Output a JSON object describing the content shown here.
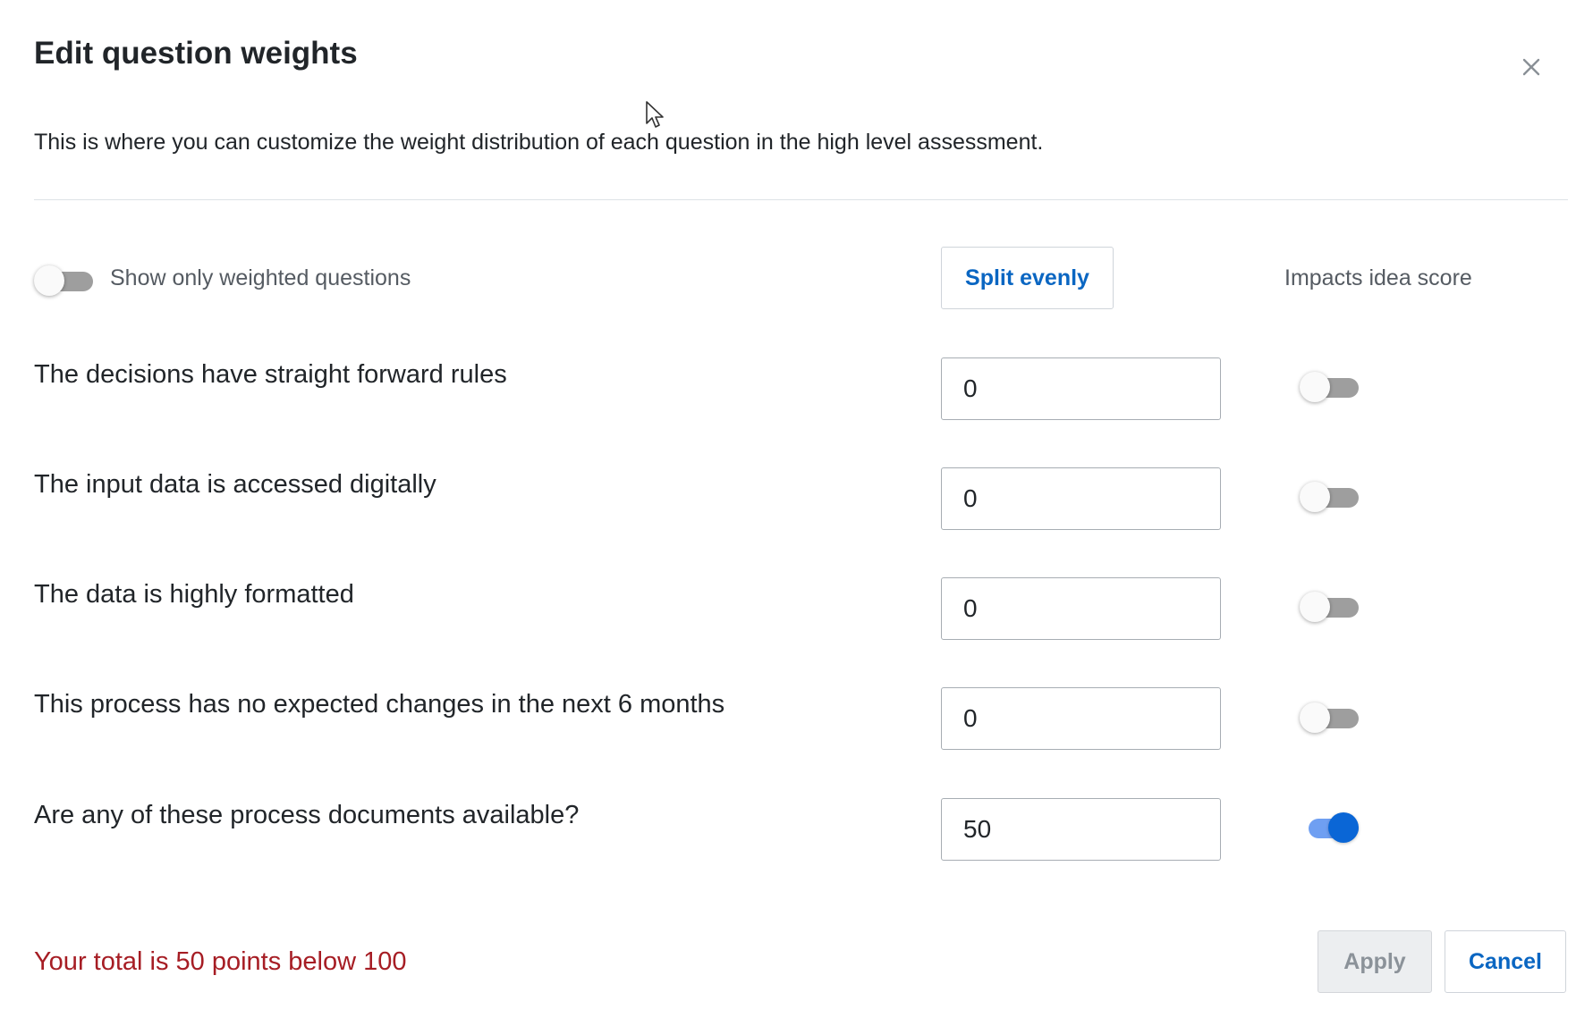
{
  "dialog": {
    "title": "Edit question weights",
    "description": "This is where you can customize the weight distribution of each question in the high level assessment.",
    "close_icon": "close-icon"
  },
  "toolbar": {
    "filter_label": "Show only weighted questions",
    "filter_on": false,
    "split_label": "Split evenly",
    "impacts_header": "Impacts idea score"
  },
  "questions": [
    {
      "text": "The decisions have straight forward rules",
      "weight": "0",
      "impacts": false
    },
    {
      "text": "The input data is accessed digitally",
      "weight": "0",
      "impacts": false
    },
    {
      "text": "The data is highly formatted",
      "weight": "0",
      "impacts": false
    },
    {
      "text": "This process has no expected changes in the next 6 months",
      "weight": "0",
      "impacts": false
    },
    {
      "text": "Are any of these process documents available?",
      "weight": "50",
      "impacts": true
    }
  ],
  "footer": {
    "total_message": "Your total is 50 points below 100",
    "apply_label": "Apply",
    "cancel_label": "Cancel"
  },
  "colors": {
    "accent": "#0a66c2",
    "toggle_on": "#0a66d6",
    "error": "#a61d24"
  }
}
